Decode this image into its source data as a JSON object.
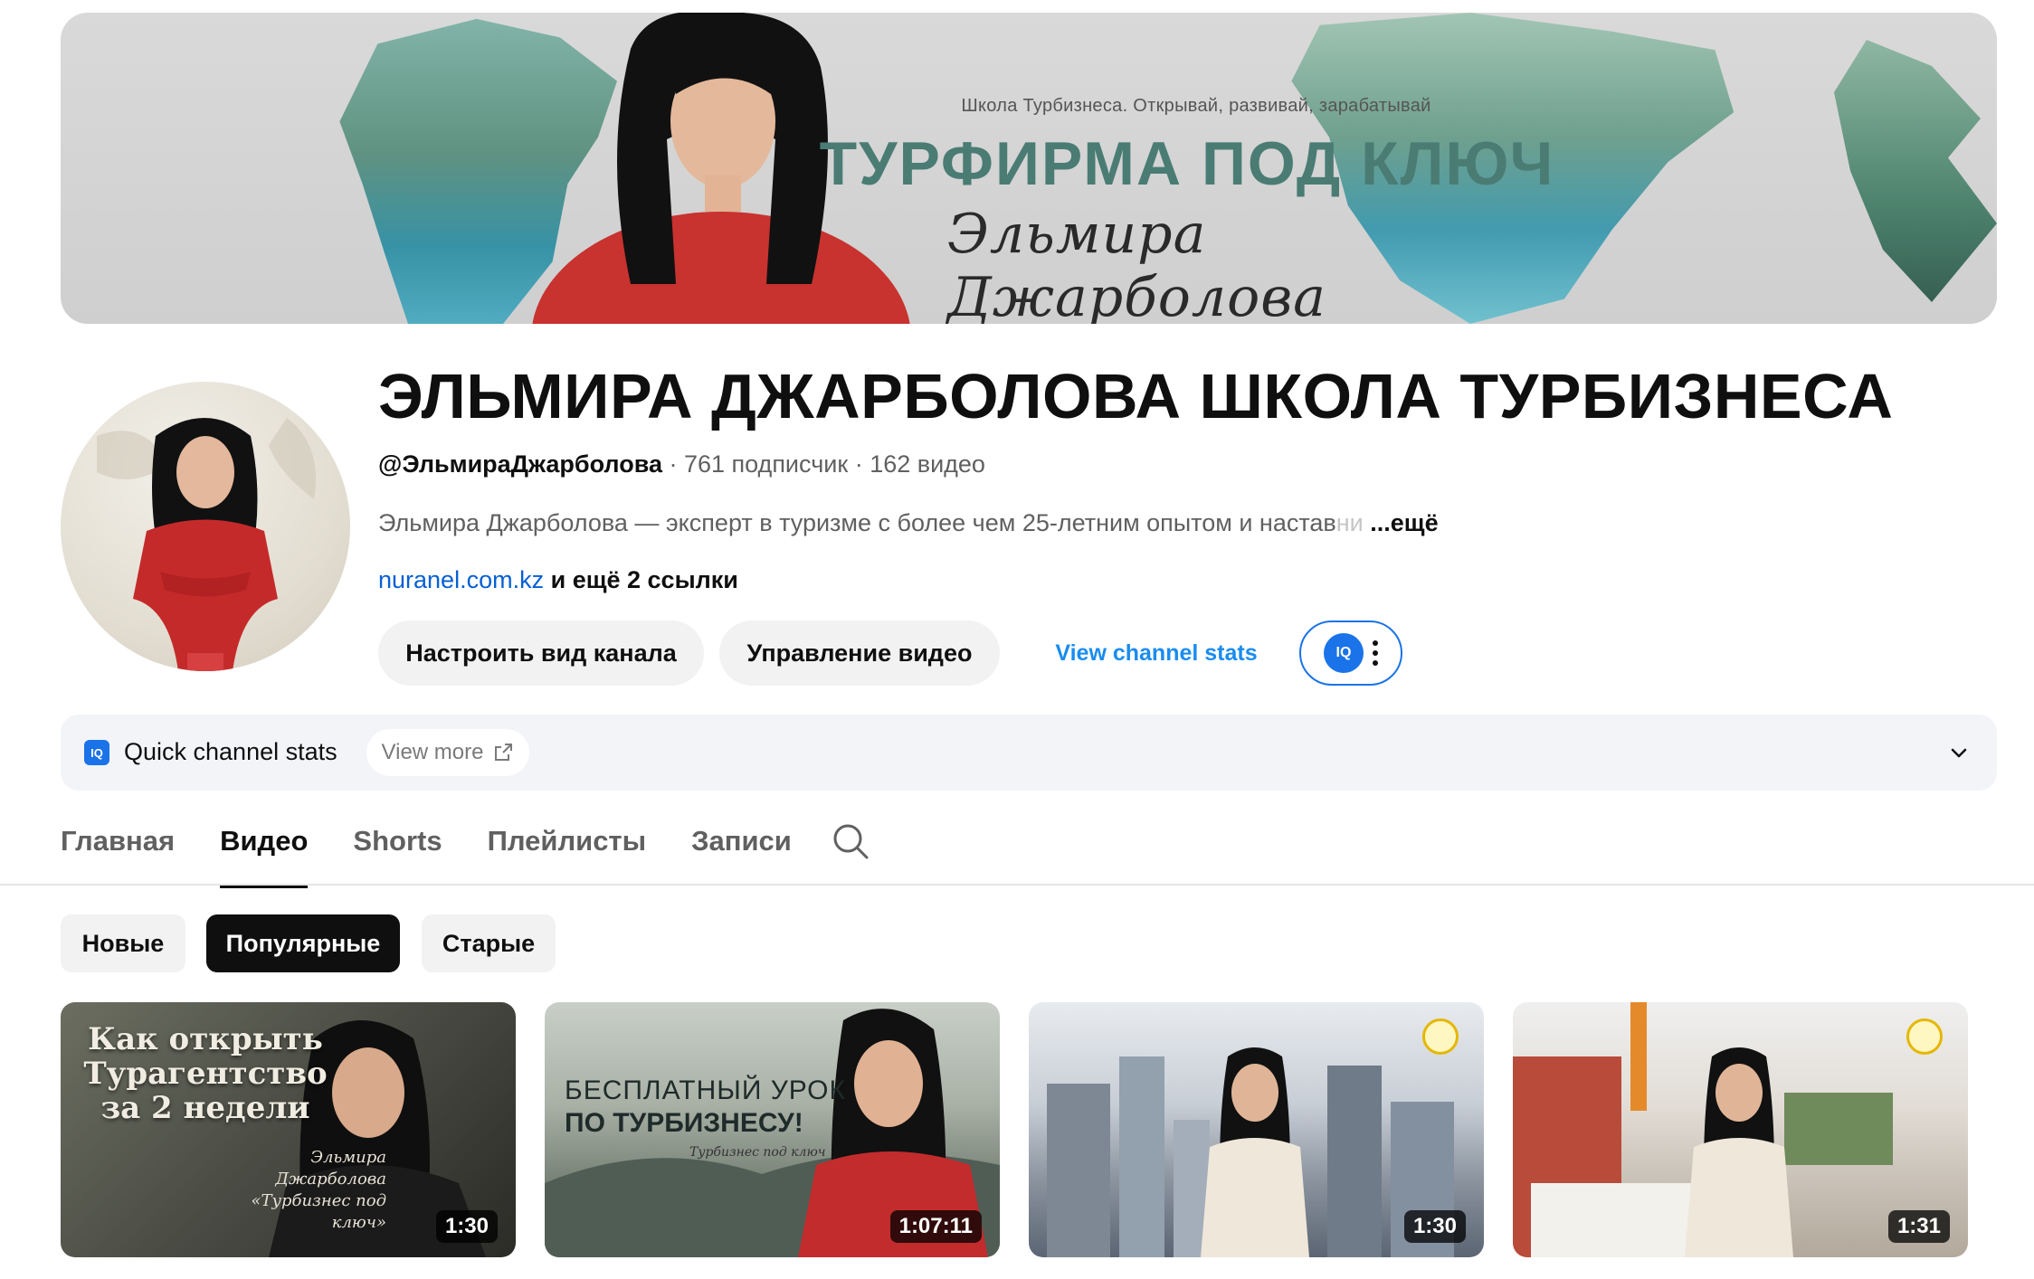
{
  "banner": {
    "subtitle": "Школа Турбизнеса. Открывай, развивай, зарабатывай",
    "headline": "ТУРФИРМА ПОД КЛЮЧ",
    "signature": "Эльмира Джарболова"
  },
  "channel": {
    "name": "ЭЛЬМИРА ДЖАРБОЛОВА ШКОЛА ТУРБИЗНЕСА",
    "handle": "@ЭльмираДжарболова",
    "subscribers": "761 подписчик",
    "videos": "162 видео",
    "separator": " · ",
    "description": "Эльмира Джарболова — эксперт в туризме с более чем 25-летним опытом и настав",
    "description_fade": "ни",
    "description_more": "...ещё",
    "link": "nuranel.com.kz",
    "link_extra": "и ещё 2 ссылки"
  },
  "actions": {
    "customize": "Настроить вид канала",
    "manage": "Управление видео",
    "stats": "View channel stats",
    "iq_badge": "IQ"
  },
  "quick_stats": {
    "icon": "IQ",
    "title": "Quick channel stats",
    "view_more": "View more"
  },
  "tabs": [
    {
      "label": "Главная",
      "active": false
    },
    {
      "label": "Видео",
      "active": true
    },
    {
      "label": "Shorts",
      "active": false
    },
    {
      "label": "Плейлисты",
      "active": false
    },
    {
      "label": "Записи",
      "active": false
    }
  ],
  "filters": [
    {
      "label": "Новые",
      "selected": false
    },
    {
      "label": "Популярные",
      "selected": true
    },
    {
      "label": "Старые",
      "selected": false
    }
  ],
  "videos": [
    {
      "duration": "1:30",
      "title_overlay": "Как открыть Турагентство за 2 недели",
      "overlay_sig": "Эльмира Джарболова «Турбизнес под ключ»"
    },
    {
      "duration": "1:07:11",
      "overlay_line1": "БЕСПЛАТНЫЙ УРОК",
      "overlay_line2": "ПО ТУРБИЗНЕСУ!",
      "overlay_sig": "Турбизнес под ключ"
    },
    {
      "duration": "1:30"
    },
    {
      "duration": "1:31"
    }
  ],
  "colors": {
    "accent_link": "#065fd4",
    "stats_blue": "#1a8cf0",
    "selected_chip": "#0f0f0f",
    "chip_bg": "#f2f2f2",
    "headline_teal": "#4a7c74"
  }
}
